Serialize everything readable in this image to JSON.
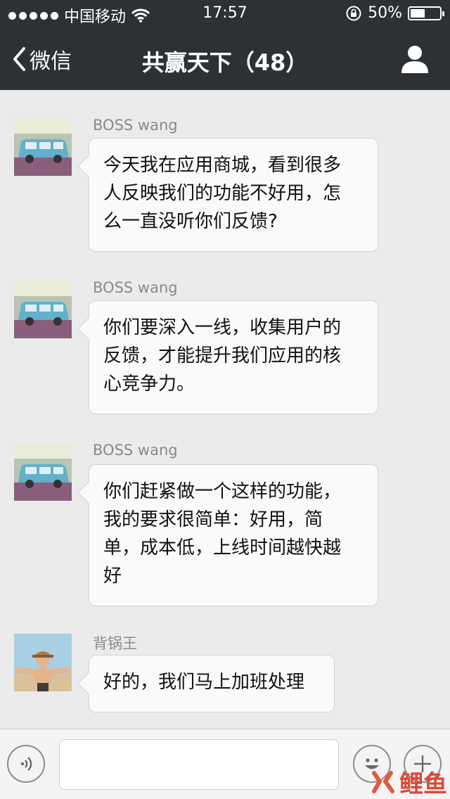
{
  "status_bar": {
    "carrier": "中国移动",
    "time": "17:57",
    "battery": "50%",
    "battery_level": 0.5
  },
  "nav": {
    "back_label": "微信",
    "title": "共赢天下（48）"
  },
  "messages": [
    {
      "sender": "BOSS wang",
      "lines": [
        "今天我在应用商城，看到很多",
        "人反映我们的功能不好用，怎",
        "么一直没听你们反馈?"
      ]
    },
    {
      "sender": "BOSS wang",
      "lines": [
        "你们要深入一线，收集用户的",
        "反馈，才能提升我们应用的核",
        "心竞争力。"
      ]
    },
    {
      "sender": "BOSS wang",
      "lines": [
        "你们赶紧做一个这样的功能，",
        "我的要求很简单：好用，简",
        "单，成本低，上线时间越快越",
        "好"
      ]
    },
    {
      "sender": "背锅王",
      "lines": [
        "好的，我们马上加班处理"
      ]
    }
  ],
  "input_bar": {
    "placeholder": ""
  },
  "watermark": {
    "text": "鲤鱼"
  },
  "colors": {
    "header_bg": "#2e3134",
    "chat_bg": "#ebebeb",
    "bubble_bg": "#fafafa"
  }
}
